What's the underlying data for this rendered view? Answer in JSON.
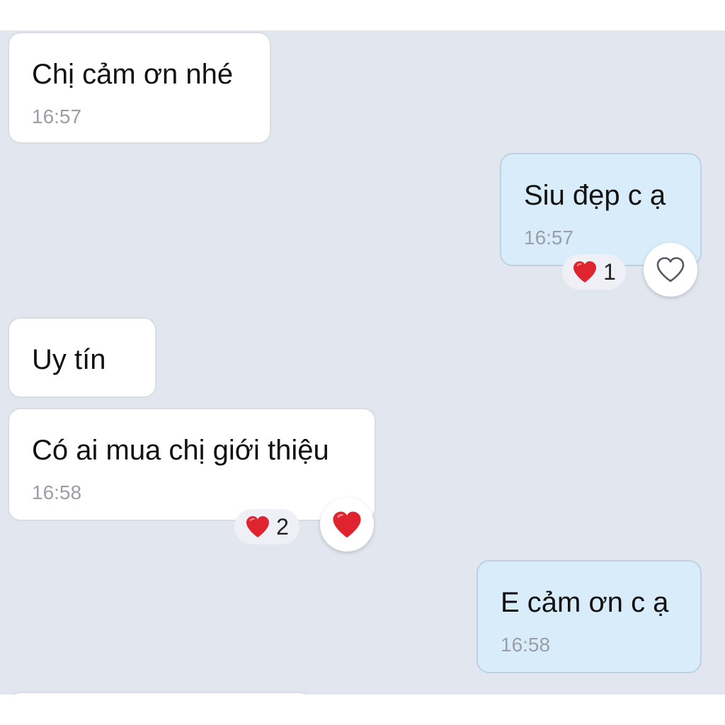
{
  "messages": [
    {
      "direction": "incoming",
      "text": "Chị cảm ơn nhé",
      "time": "16:57"
    },
    {
      "direction": "outgoing",
      "text": "Siu đẹp c ạ",
      "time": "16:57",
      "reaction": {
        "emoji": "heart",
        "count": "1"
      }
    },
    {
      "direction": "incoming",
      "text": "Uy tín"
    },
    {
      "direction": "incoming",
      "text": "Có ai mua chị giới thiệu",
      "time": "16:58",
      "reaction": {
        "emoji": "heart",
        "count": "2"
      }
    },
    {
      "direction": "outgoing",
      "text": "E cảm ơn c ạ",
      "time": "16:58"
    }
  ],
  "reaction_buttons": [
    {
      "icon": "heart-outline-icon",
      "state": "not-reacted"
    },
    {
      "icon": "heart-filled-icon",
      "state": "reacted"
    }
  ],
  "colors": {
    "chat_background": "#e2e6ef",
    "incoming_bubble": "#ffffff",
    "outgoing_bubble": "#d8ecfa",
    "heart": "#e0242f",
    "timestamp": "#9a9ea6"
  }
}
